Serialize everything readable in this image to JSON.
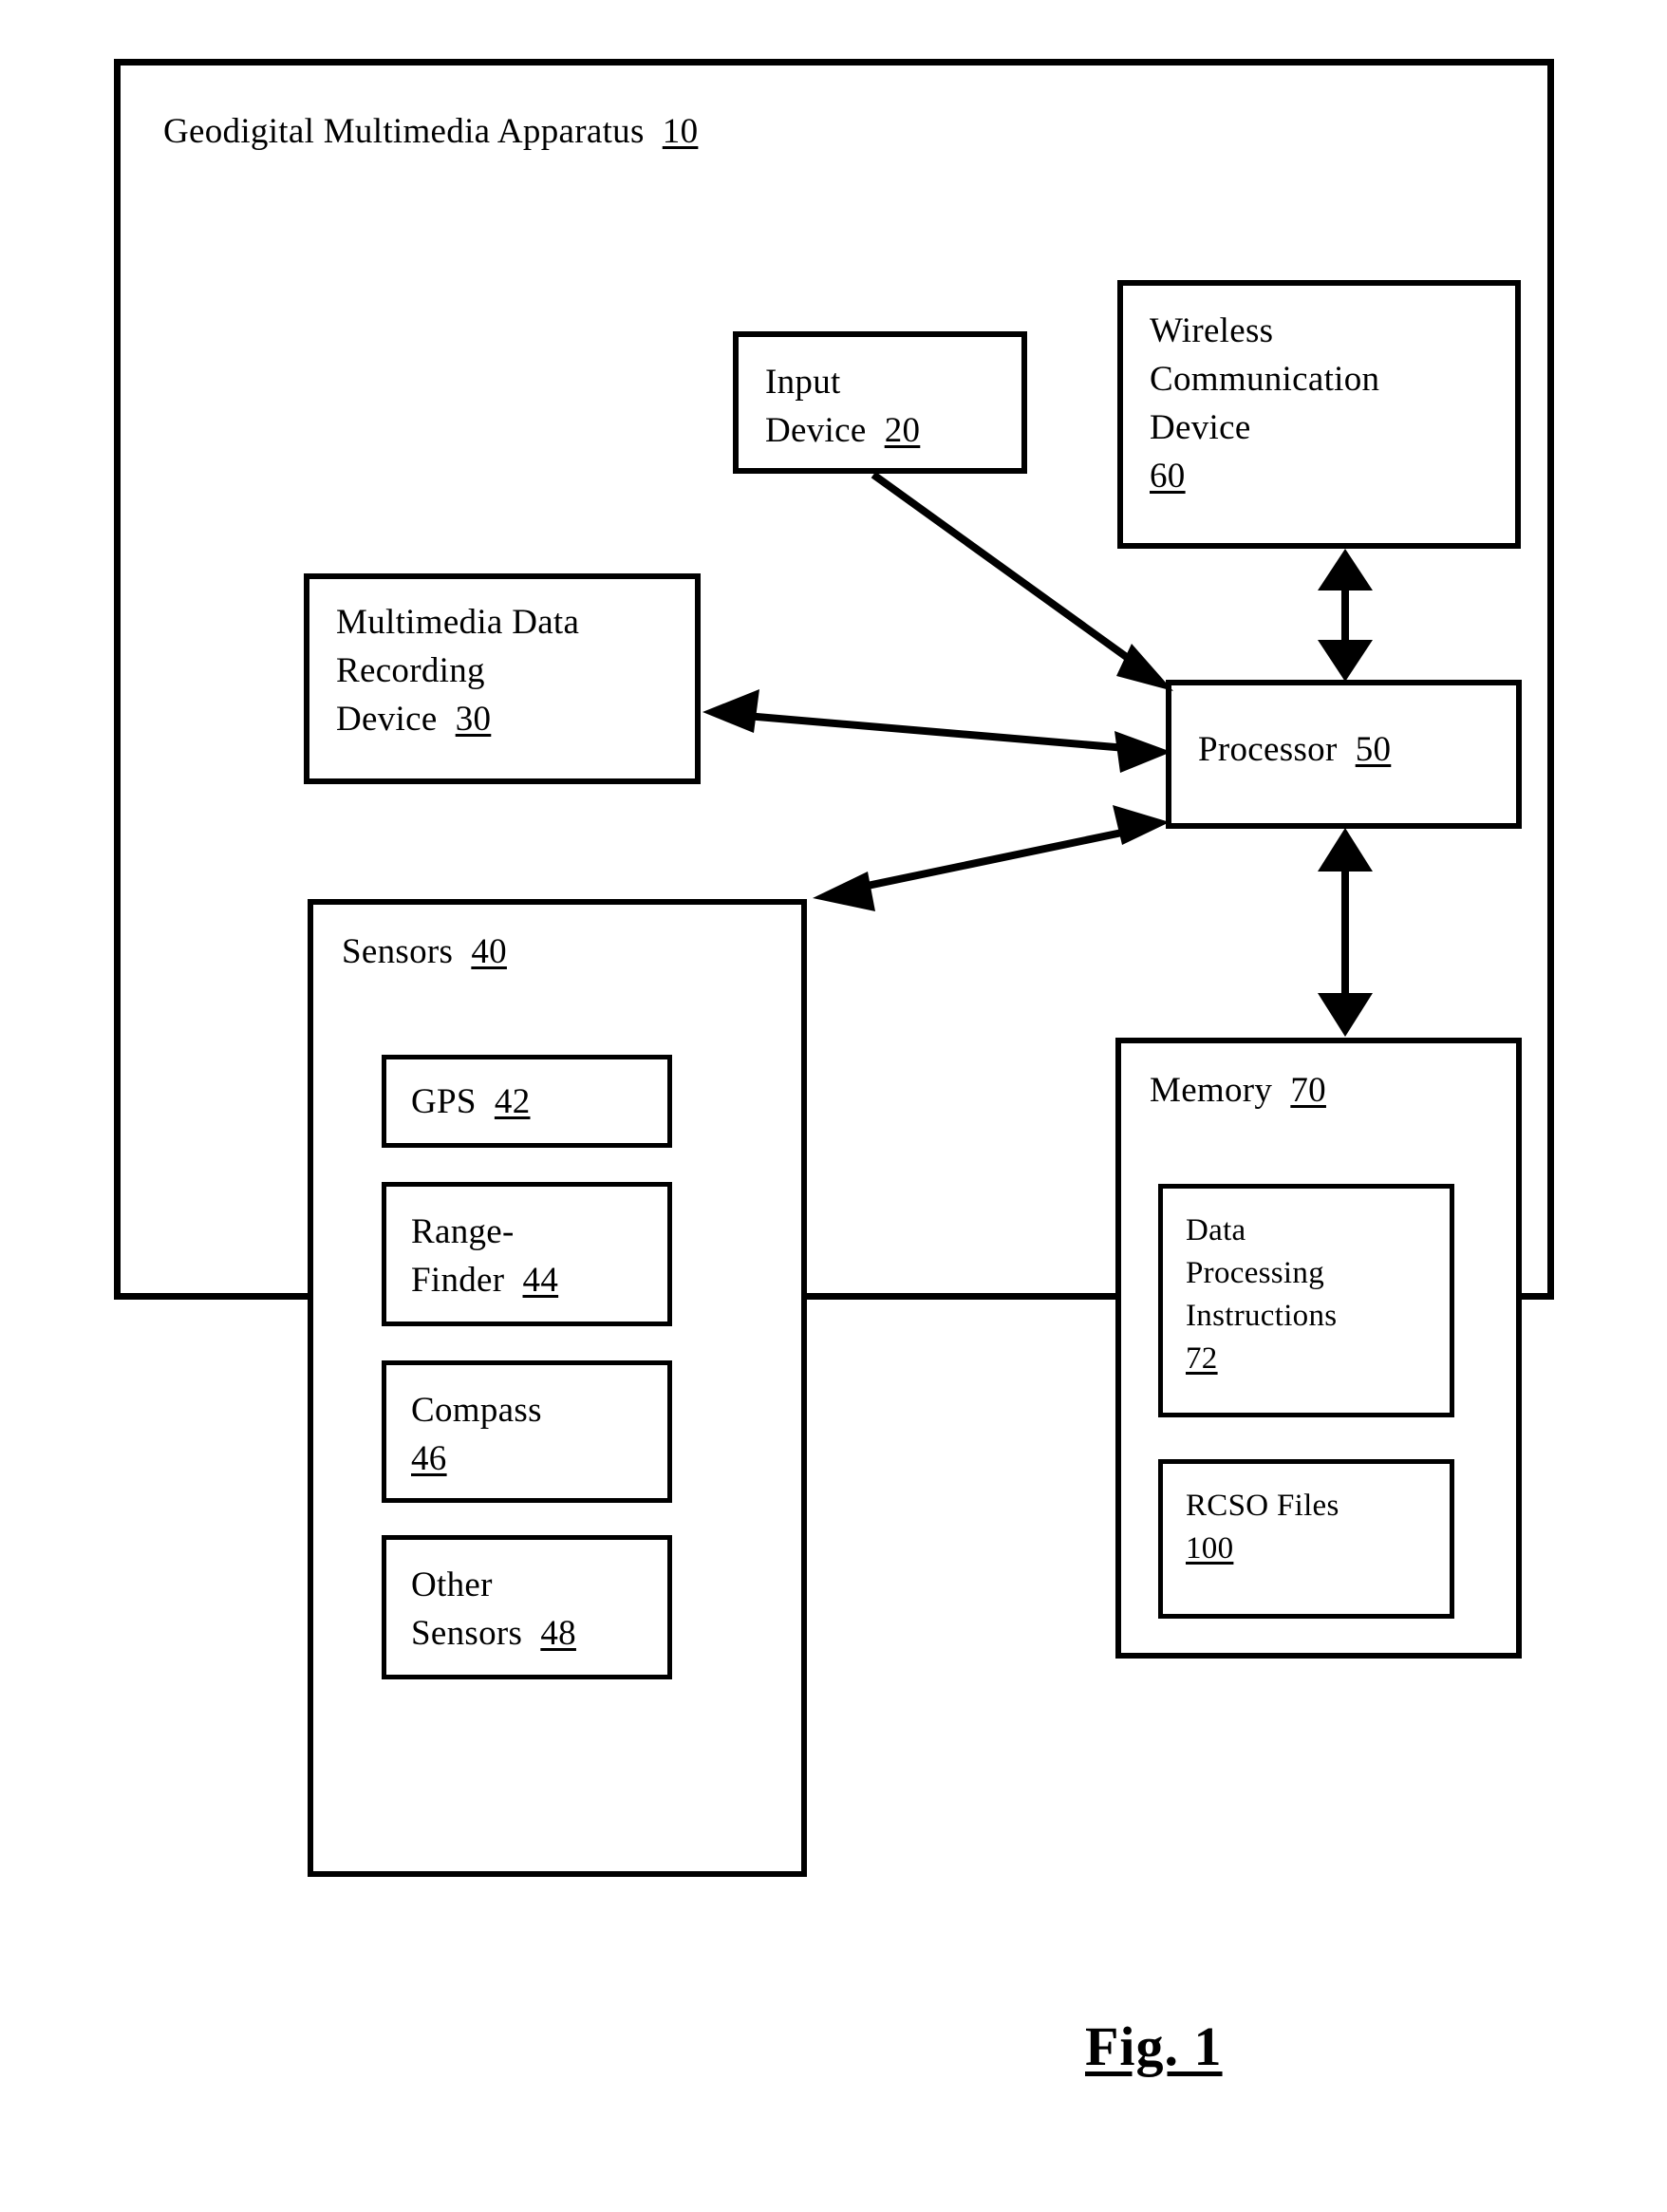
{
  "figure": {
    "caption": "Fig. 1",
    "apparatus_title": "Geodigital Multimedia Apparatus",
    "apparatus_ref": "10"
  },
  "blocks": {
    "input_device": {
      "label": "Input\nDevice",
      "ref": "20"
    },
    "wireless_communication_device": {
      "label": "Wireless\nCommunication\nDevice",
      "ref": "60"
    },
    "multimedia_data_recording_device": {
      "label": "Multimedia Data\nRecording\nDevice",
      "ref": "30"
    },
    "processor": {
      "label": "Processor",
      "ref": "50"
    },
    "sensors": {
      "label": "Sensors",
      "ref": "40"
    },
    "gps": {
      "label": "GPS",
      "ref": "42"
    },
    "range_finder": {
      "label": "Range-\nFinder",
      "ref": "44"
    },
    "compass": {
      "label": "Compass",
      "ref": "46"
    },
    "other_sensors": {
      "label": "Other\nSensors",
      "ref": "48"
    },
    "memory": {
      "label": "Memory",
      "ref": "70"
    },
    "data_processing_instructions": {
      "label": "Data\nProcessing\nInstructions",
      "ref": "72"
    },
    "rcso_files": {
      "label": "RCSO Files",
      "ref": "100"
    }
  },
  "connections": [
    {
      "name": "input-device-to-processor",
      "from": "input_device",
      "to": "processor",
      "direction": "one-way"
    },
    {
      "name": "wireless-device-to-processor",
      "from": "wireless_communication_device",
      "to": "processor",
      "direction": "two-way"
    },
    {
      "name": "multimedia-recording-to-processor",
      "from": "multimedia_data_recording_device",
      "to": "processor",
      "direction": "two-way"
    },
    {
      "name": "sensors-to-processor",
      "from": "sensors",
      "to": "processor",
      "direction": "two-way"
    },
    {
      "name": "processor-to-memory",
      "from": "processor",
      "to": "memory",
      "direction": "two-way"
    }
  ],
  "colors": {
    "stroke": "#000000",
    "background": "#ffffff"
  }
}
